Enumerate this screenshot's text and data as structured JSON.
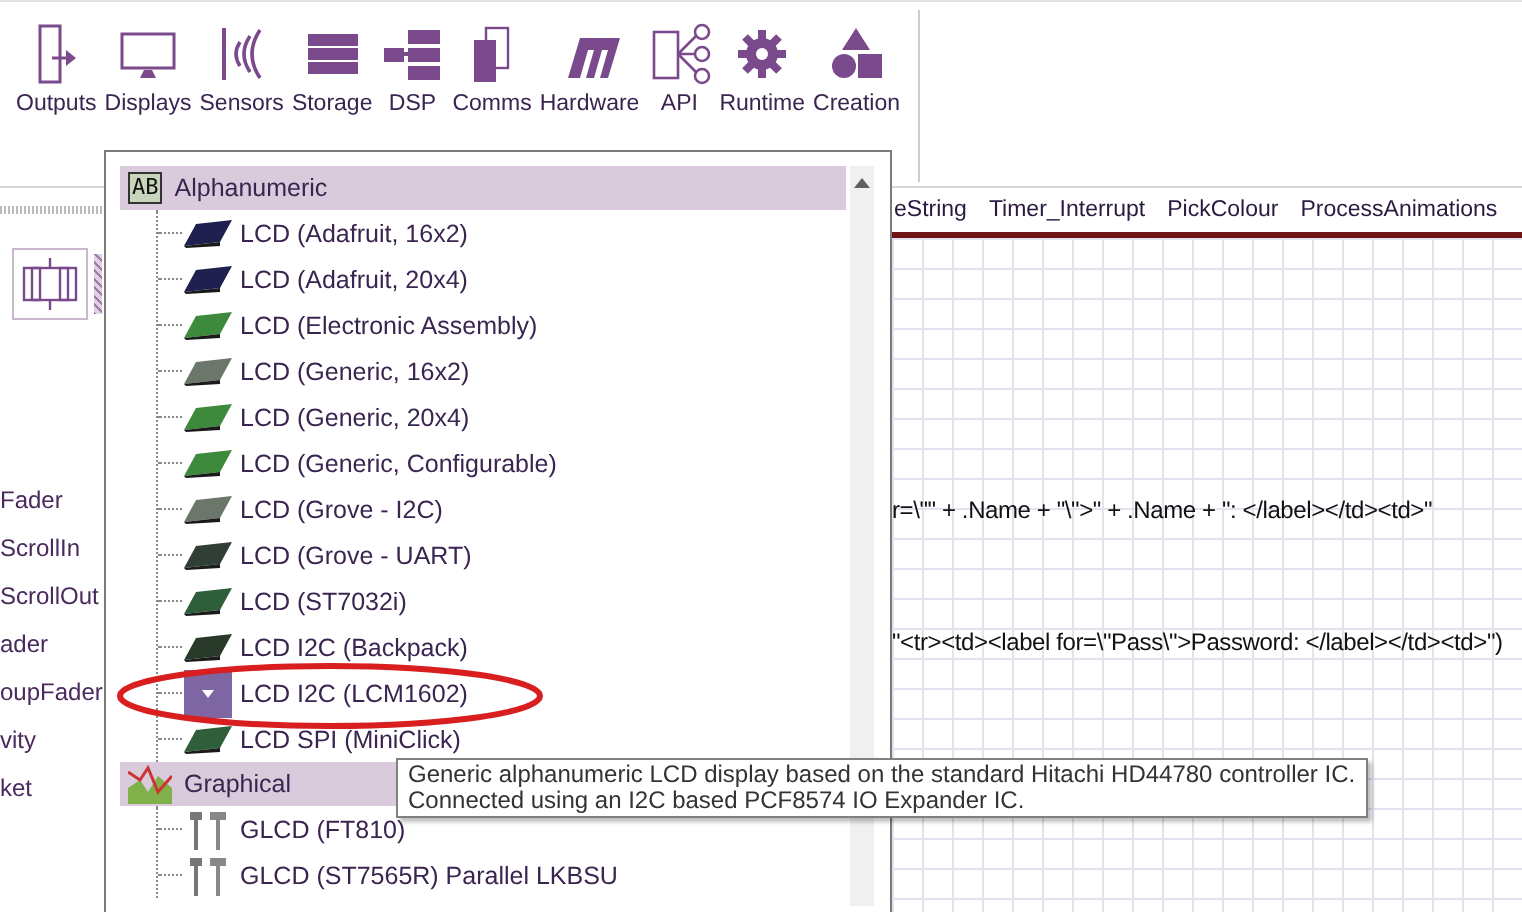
{
  "toolbar": {
    "items": [
      {
        "label": "Outputs"
      },
      {
        "label": "Displays"
      },
      {
        "label": "Sensors"
      },
      {
        "label": "Storage"
      },
      {
        "label": "DSP"
      },
      {
        "label": "Comms"
      },
      {
        "label": "Hardware"
      },
      {
        "label": "API"
      },
      {
        "label": "Runtime"
      },
      {
        "label": "Creation"
      }
    ]
  },
  "left_panel": {
    "labels": [
      "Fader",
      "ScrollIn",
      "ScrollOut",
      "ader",
      "oupFader",
      "vity",
      "ket"
    ]
  },
  "code_tabs": [
    {
      "label": "eString"
    },
    {
      "label": "Timer_Interrupt"
    },
    {
      "label": "PickColour"
    },
    {
      "label": "ProcessAnimations"
    }
  ],
  "canvas": {
    "code_lines": [
      "r=\\\"\" + .Name + \"\\\">\" + .Name + \": </label></td><td>\"",
      "\"<tr><td><label for=\\\"Pass\\\">Password: </label></td><td>\")"
    ]
  },
  "component_menu": {
    "groups": [
      {
        "label": "Alphanumeric",
        "badge": "AB",
        "items": [
          {
            "label": "LCD (Adafruit, 16x2)",
            "kind": "lcd",
            "color": "#1f2050",
            "selected": false
          },
          {
            "label": "LCD (Adafruit, 20x4)",
            "kind": "lcd",
            "color": "#1f2050",
            "selected": false
          },
          {
            "label": "LCD (Electronic Assembly)",
            "kind": "lcd",
            "color": "#3d8a3d",
            "selected": false
          },
          {
            "label": "LCD (Generic, 16x2)",
            "kind": "lcd",
            "color": "#6b776b",
            "selected": false
          },
          {
            "label": "LCD (Generic, 20x4)",
            "kind": "lcd",
            "color": "#3d8a3d",
            "selected": false
          },
          {
            "label": "LCD (Generic, Configurable)",
            "kind": "lcd",
            "color": "#3d8a3d",
            "selected": false
          },
          {
            "label": "LCD (Grove - I2C)",
            "kind": "lcd",
            "color": "#6b776b",
            "selected": false
          },
          {
            "label": "LCD (Grove - UART)",
            "kind": "lcd",
            "color": "#2f3f35",
            "selected": false
          },
          {
            "label": "LCD (ST7032i)",
            "kind": "lcd",
            "color": "#2f5f3a",
            "selected": false
          },
          {
            "label": "LCD I2C (Backpack)",
            "kind": "lcd",
            "color": "#2a3a2a",
            "selected": false
          },
          {
            "label": "LCD I2C (LCM1602)",
            "kind": "lcd",
            "selected": true
          },
          {
            "label": "LCD SPI (MiniClick)",
            "kind": "lcd",
            "color": "#2f5f3a",
            "selected": false
          }
        ]
      },
      {
        "label": "Graphical",
        "items": [
          {
            "label": "GLCD (FT810)",
            "kind": "tool",
            "selected": false
          },
          {
            "label": "GLCD (ST7565R) Parallel LKBSU",
            "kind": "tool",
            "selected": false
          }
        ]
      }
    ]
  },
  "tooltip": {
    "lines": [
      "Generic alphanumeric LCD display based on the standard Hitachi HD44780 controller IC.",
      "Connected using an I2C based PCF8574 IO Expander IC."
    ]
  }
}
